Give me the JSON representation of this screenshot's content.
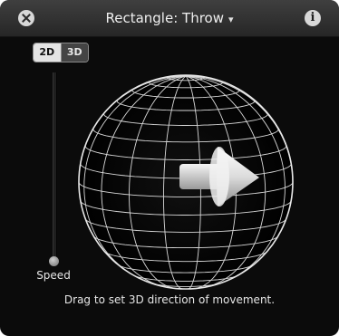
{
  "window": {
    "title": "Rectangle: Throw",
    "caret": "▾",
    "close_icon": "close-icon",
    "info_label": "i"
  },
  "mode_toggle": {
    "options": [
      "2D",
      "3D"
    ],
    "selected": "2D"
  },
  "speed": {
    "label": "Speed",
    "value_fraction": 0.0
  },
  "direction_control": {
    "hint": "Drag to set 3D direction of movement.",
    "arrow_direction": "right"
  },
  "colors": {
    "hud_background": "#0b0b0b",
    "titlebar": "#333333",
    "text": "#e6e6e6"
  }
}
